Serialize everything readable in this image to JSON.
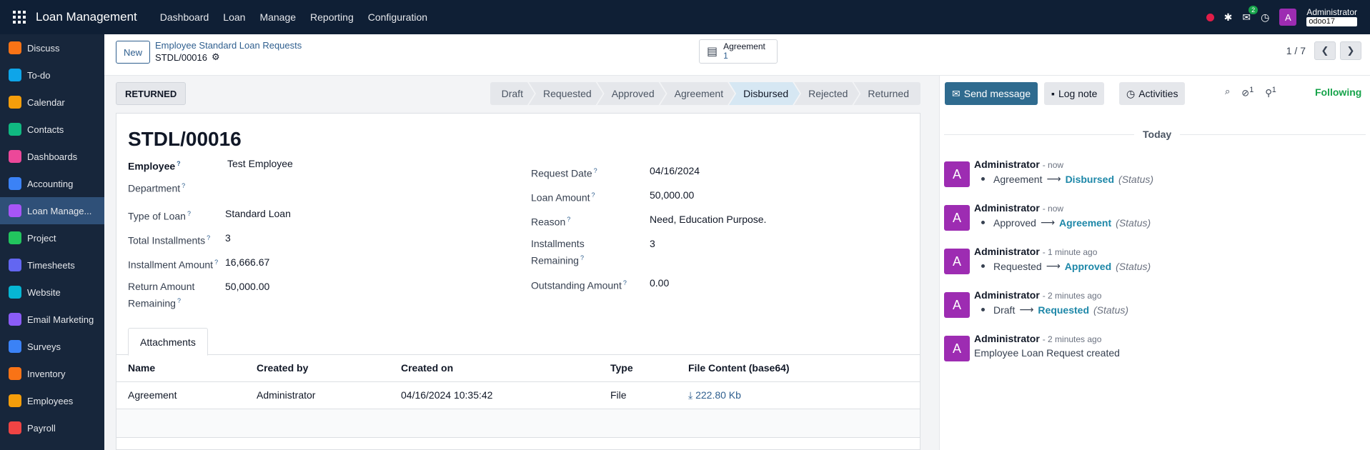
{
  "navbar": {
    "brand": "Loan Management",
    "menu": [
      "Dashboard",
      "Loan",
      "Manage",
      "Reporting",
      "Configuration"
    ],
    "chat_badge": "2",
    "user_initial": "A",
    "user_name": "Administrator",
    "db_name": "odoo17"
  },
  "sidebar": {
    "items": [
      {
        "label": "Discuss",
        "color": "#f97316"
      },
      {
        "label": "To-do",
        "color": "#0ea5e9"
      },
      {
        "label": "Calendar",
        "color": "#f59e0b"
      },
      {
        "label": "Contacts",
        "color": "#10b981"
      },
      {
        "label": "Dashboards",
        "color": "#ec4899"
      },
      {
        "label": "Accounting",
        "color": "#3b82f6"
      },
      {
        "label": "Loan Manage...",
        "color": "#a855f7"
      },
      {
        "label": "Project",
        "color": "#22c55e"
      },
      {
        "label": "Timesheets",
        "color": "#6366f1"
      },
      {
        "label": "Website",
        "color": "#06b6d4"
      },
      {
        "label": "Email Marketing",
        "color": "#8b5cf6"
      },
      {
        "label": "Surveys",
        "color": "#3b82f6"
      },
      {
        "label": "Inventory",
        "color": "#f97316"
      },
      {
        "label": "Employees",
        "color": "#f59e0b"
      },
      {
        "label": "Payroll",
        "color": "#ef4444"
      }
    ]
  },
  "control_panel": {
    "new_label": "New",
    "breadcrumb_parent": "Employee Standard Loan Requests",
    "breadcrumb_current": "STDL/00016",
    "smart_button_label": "Agreement",
    "smart_button_count": "1",
    "pager": "1 / 7"
  },
  "status": {
    "button_label": "RETURNED",
    "stages": [
      "Draft",
      "Requested",
      "Approved",
      "Agreement",
      "Disbursed",
      "Rejected",
      "Returned"
    ],
    "current_stage": "Disbursed"
  },
  "form": {
    "name": "STDL/00016",
    "left": [
      {
        "label": "Employee",
        "value": "Test Employee"
      },
      {
        "label": "Department",
        "value": ""
      },
      {
        "label": "Type of Loan",
        "value": "Standard Loan"
      },
      {
        "label": "Total Installments",
        "value": "3"
      },
      {
        "label": "Installment Amount",
        "value": "16,666.67"
      },
      {
        "label": "Return Amount",
        "label2": "Remaining",
        "value": "50,000.00"
      }
    ],
    "right": [
      {
        "label": "Request Date",
        "value": "04/16/2024"
      },
      {
        "label": "Loan Amount",
        "value": "50,000.00"
      },
      {
        "label": "Reason",
        "value": "Need, Education Purpose."
      },
      {
        "label": "Installments",
        "label2": "Remaining",
        "value": "3"
      },
      {
        "label": "Outstanding Amount",
        "value": "0.00"
      }
    ],
    "tab_label": "Attachments",
    "columns": [
      "Name",
      "Created by",
      "Created on",
      "Type",
      "File Content (base64)"
    ],
    "rows": [
      {
        "name": "Agreement",
        "created_by": "Administrator",
        "created_on": "04/16/2024 10:35:42",
        "type": "File",
        "content": "222.80 Kb"
      }
    ]
  },
  "chatter": {
    "send_message": "Send message",
    "log_note": "Log note",
    "activities": "Activities",
    "attachments_count": "1",
    "followers_count": "1",
    "following": "Following",
    "day_separator": "Today",
    "messages": [
      {
        "author": "Administrator",
        "when": "- now",
        "old": "Agreement",
        "new": "Disbursed",
        "field": "(Status)"
      },
      {
        "author": "Administrator",
        "when": "- now",
        "old": "Approved",
        "new": "Agreement",
        "field": "(Status)"
      },
      {
        "author": "Administrator",
        "when": "- 1 minute ago",
        "old": "Requested",
        "new": "Approved",
        "field": "(Status)"
      },
      {
        "author": "Administrator",
        "when": "- 2 minutes ago",
        "old": "Draft",
        "new": "Requested",
        "field": "(Status)"
      },
      {
        "author": "Administrator",
        "when": "- 2 minutes ago",
        "body": "Employee Loan Request created"
      }
    ]
  }
}
